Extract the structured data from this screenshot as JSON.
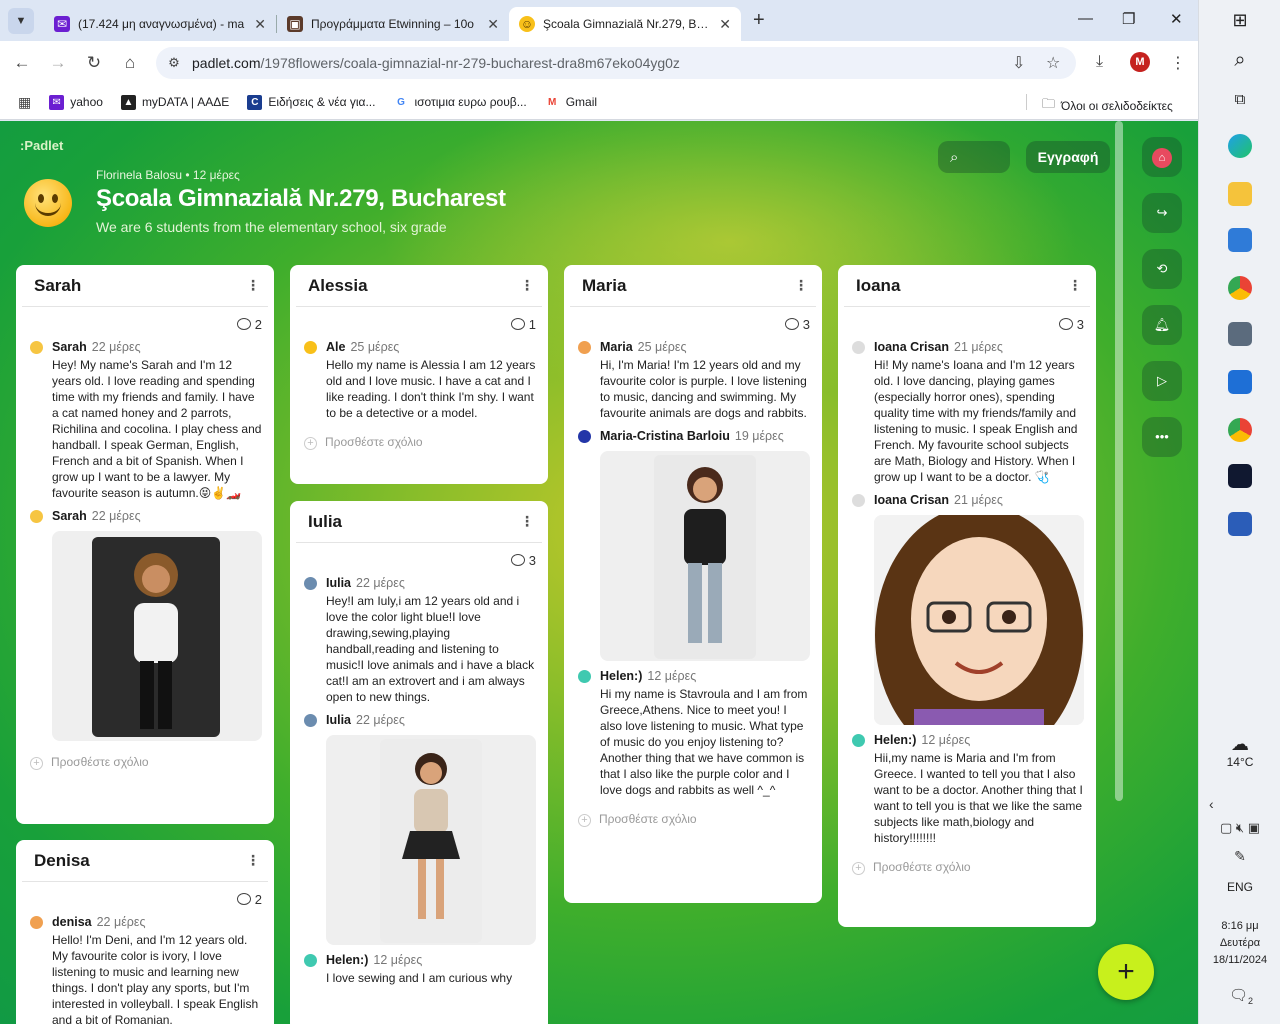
{
  "browser": {
    "tabs": [
      {
        "label": "(17.424 μη αναγνωσμένα) - ma",
        "icon": "yahoo-mail-icon"
      },
      {
        "label": "Προγράμματα Etwinning – 10o",
        "icon": "site-icon"
      },
      {
        "label": "Şcoala Gimnazială Nr.279, Buch",
        "icon": "padlet-emoji-icon"
      }
    ],
    "url_host": "padlet.com",
    "url_path": "/1978flowers/coala-gimnazial-nr-279-bucharest-dra8m67eko04yg0z",
    "profile_letter": "M",
    "bookmarks": [
      "yahoo",
      "myDATA | ΑΑΔΕ",
      "Ειδήσεις & νέα για...",
      "ισοτιμια ευρω ρουβ...",
      "Gmail"
    ],
    "all_bookmarks": "Όλοι οι σελιδοδείκτες"
  },
  "padlet": {
    "logo": ":Padlet",
    "author_line": "Florinela Balosu • 12 μέρες",
    "title": "Şcoala Gimnazială Nr.279, Bucharest",
    "description": "We are 6 students from the elementary school, six grade",
    "signup": "Εγγραφή",
    "add_comment": "Προσθέστε σχόλιο",
    "columns": {
      "sarah": {
        "name": "Sarah",
        "count": "2",
        "e1": {
          "author": "Sarah",
          "time": "22 μέρες",
          "text": "Hey! My name's Sarah and I'm 12 years old. I love reading and spending time with my friends and family. I have a cat named honey and 2 parrots, Richilina and cocolina. I play chess and handball. I speak German, English, French and a bit of Spanish. When I grow up I want to be a lawyer. My favourite season is autumn.😝✌️🏎️"
        },
        "e2": {
          "author": "Sarah",
          "time": "22 μέρες"
        }
      },
      "denisa": {
        "name": "Denisa",
        "count": "2",
        "e1": {
          "author": "denisa",
          "time": "22 μέρες",
          "text": "Hello! I'm Deni, and I'm 12 years old. My favourite color is ivory, I love listening to music and learning new things. I don't play any sports, but I'm interested in volleyball. I speak English and a bit of Romanian."
        }
      },
      "alessia": {
        "name": "Alessia",
        "count": "1",
        "e1": {
          "author": "Ale",
          "time": "25 μέρες",
          "text": "Hello my name is Alessia I am 12 years old and I love music. I have a cat and I like reading. I don't think I'm shy. I want to be a detective or a model."
        }
      },
      "iulia": {
        "name": "Iulia",
        "count": "3",
        "e1": {
          "author": "Iulia",
          "time": "22 μέρες",
          "text": "Hey!I am Iuly,i am 12 years old and i love the color light blue!I love drawing,sewing,playing handball,reading and listening to music!I love animals and i have a black cat!I am an extrovert and i am always open to new things."
        },
        "e2": {
          "author": "Iulia",
          "time": "22 μέρες"
        },
        "e3": {
          "author": "Helen:)",
          "time": "12 μέρες",
          "text": "I love sewing and I am curious why"
        }
      },
      "maria": {
        "name": "Maria",
        "count": "3",
        "e1": {
          "author": "Maria",
          "time": "25 μέρες",
          "text": "Hi, I'm Maria! I'm 12 years old and my favourite color is purple. I love listening to music, dancing and swimming. My favourite animals are dogs and rabbits."
        },
        "e2": {
          "author": "Maria-Cristina Barloiu",
          "time": "19 μέρες"
        },
        "e3": {
          "author": "Helen:)",
          "time": "12 μέρες",
          "text": "Hi my name is Stavroula and I am from Greece,Athens. Nice to meet you! I also love listening to music. What type of music do you enjoy listening to? Another thing that we have common is that I also like the purple color and I love dogs and rabbits as well ^_^"
        }
      },
      "ioana": {
        "name": "Ioana",
        "count": "3",
        "e1": {
          "author": "Ioana Crisan",
          "time": "21 μέρες",
          "text": "Hi! My name's Ioana and I'm 12 years old. I love dancing, playing games (especially horror ones), spending quality time with my friends/family and listening to music. I speak English and French. My favourite school subjects are Math, Biology and History. When I grow up I want to be a doctor. 🩺"
        },
        "e2": {
          "author": "Ioana Crisan",
          "time": "21 μέρες"
        },
        "e3": {
          "author": "Helen:)",
          "time": "12 μέρες",
          "text": "Hii,my name is Maria and I'm from Greece. I wanted to tell you that I also want to be a doctor. Another thing that I want to tell you is that we like the same subjects like math,biology and history!!!!!!!!"
        }
      }
    }
  },
  "taskbar": {
    "temperature": "14°C",
    "language": "ENG",
    "time": "8:16 μμ",
    "day": "Δευτέρα",
    "date": "18/11/2024",
    "notifications": "2"
  }
}
